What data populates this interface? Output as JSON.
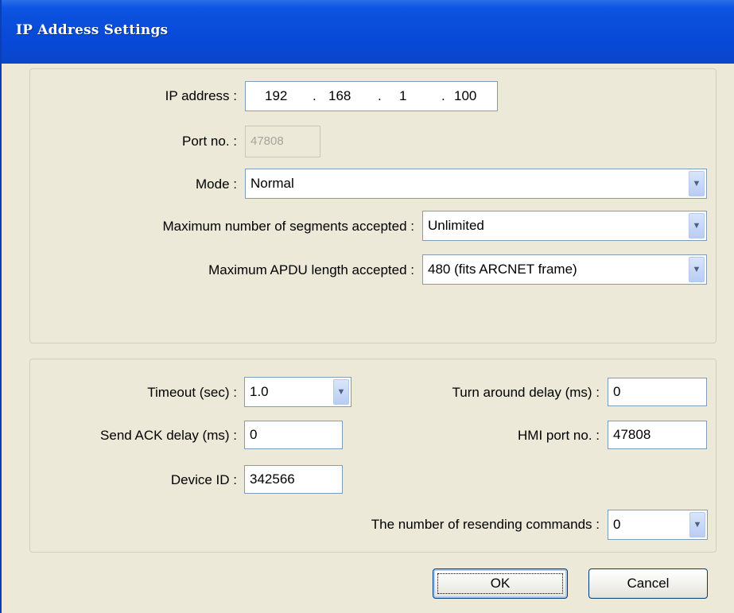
{
  "window": {
    "title": "IP Address Settings"
  },
  "ip": {
    "label": "IP address :",
    "octet1": "192",
    "octet2": "168",
    "octet3": "1",
    "octet4": "100",
    "dot": "."
  },
  "port": {
    "label": "Port no. :",
    "value": "47808"
  },
  "mode": {
    "label": "Mode :",
    "value": "Normal"
  },
  "segments": {
    "label": "Maximum number of segments accepted :",
    "value": "Unlimited"
  },
  "apdu": {
    "label": "Maximum APDU length accepted :",
    "value": "480 (fits ARCNET frame)"
  },
  "timeout": {
    "label": "Timeout (sec) :",
    "value": "1.0"
  },
  "turn_around": {
    "label": "Turn around delay (ms) :",
    "value": "0"
  },
  "ack_delay": {
    "label": "Send ACK delay (ms) :",
    "value": "0"
  },
  "hmi_port": {
    "label": "HMI port no. :",
    "value": "47808"
  },
  "device_id": {
    "label": "Device ID :",
    "value": "342566"
  },
  "resend": {
    "label": "The number of resending commands :",
    "value": "0"
  },
  "buttons": {
    "ok": "OK",
    "cancel": "Cancel"
  },
  "icons": {
    "dropdown": "chevron-down-icon"
  },
  "colors": {
    "titlebar": "#0a4fdc",
    "dialog_bg": "#ece9d8",
    "field_border": "#7f9db9"
  }
}
